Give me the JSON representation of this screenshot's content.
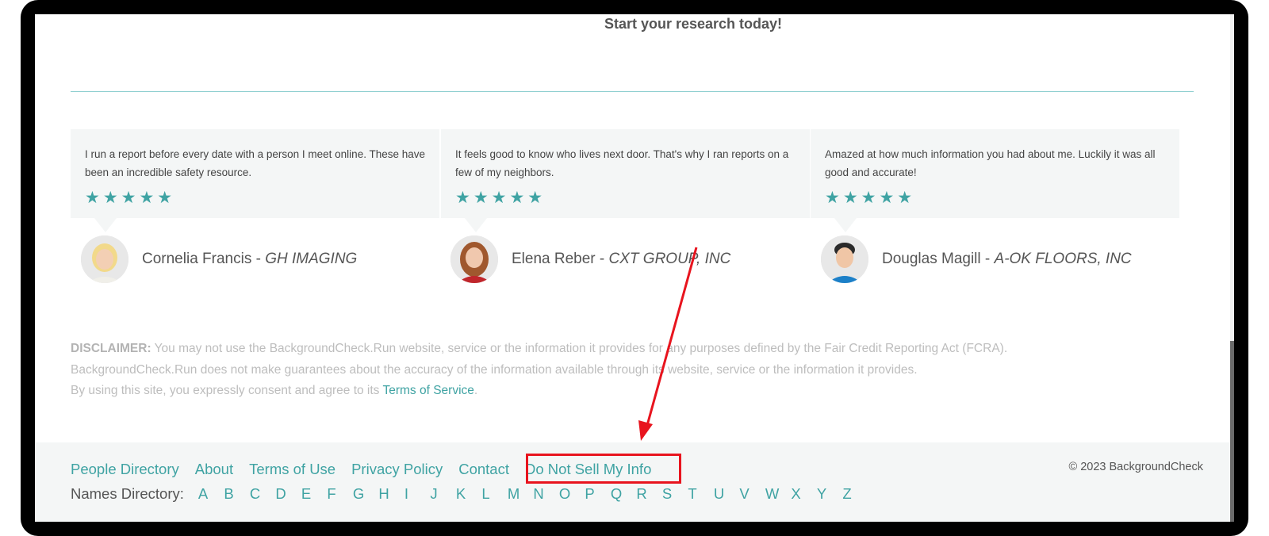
{
  "cta": "Start your research today!",
  "testimonials": [
    {
      "text": "I run a report before every date with a person I meet online. These have been an incredible safety resource.",
      "stars": "★★★★★",
      "name": "Cornelia Francis",
      "separator": " - ",
      "company": "GH IMAGING"
    },
    {
      "text": "It feels good to know who lives next door. That's why I ran reports on a few of my neighbors.",
      "stars": "★★★★★",
      "name": "Elena Reber",
      "separator": " - ",
      "company": "CXT GROUP, INC"
    },
    {
      "text": "Amazed at how much information you had about me. Luckily it was all good and accurate!",
      "stars": "★★★★★",
      "name": "Douglas Magill",
      "separator": " - ",
      "company": "A-OK FLOORS, INC"
    }
  ],
  "disclaimer": {
    "label": "DISCLAIMER:",
    "line1": " You may not use the BackgroundCheck.Run website, service or the information it provides for any purposes defined by the Fair Credit Reporting Act (FCRA).",
    "line2": "BackgroundCheck.Run does not make guarantees about the accuracy of the information available through its website, service or the information it provides.",
    "line3_prefix": "By using this site, you expressly consent and agree to its ",
    "line3_link": "Terms of Service",
    "line3_suffix": "."
  },
  "footer": {
    "links": [
      "People Directory",
      "About",
      "Terms of Use",
      "Privacy Policy",
      "Contact",
      "Do Not Sell My Info"
    ],
    "names_label": "Names Directory:",
    "letters": [
      "A",
      "B",
      "C",
      "D",
      "E",
      "F",
      "G",
      "H",
      "I",
      "J",
      "K",
      "L",
      "M",
      "N",
      "O",
      "P",
      "Q",
      "R",
      "S",
      "T",
      "U",
      "V",
      "W",
      "X",
      "Y",
      "Z"
    ],
    "copyright": "© 2023 BackgroundCheck"
  },
  "colors": {
    "accent": "#3fa3a3",
    "annotation": "#e8141e"
  },
  "icons": [
    "star-icon",
    "annotation-arrow"
  ]
}
